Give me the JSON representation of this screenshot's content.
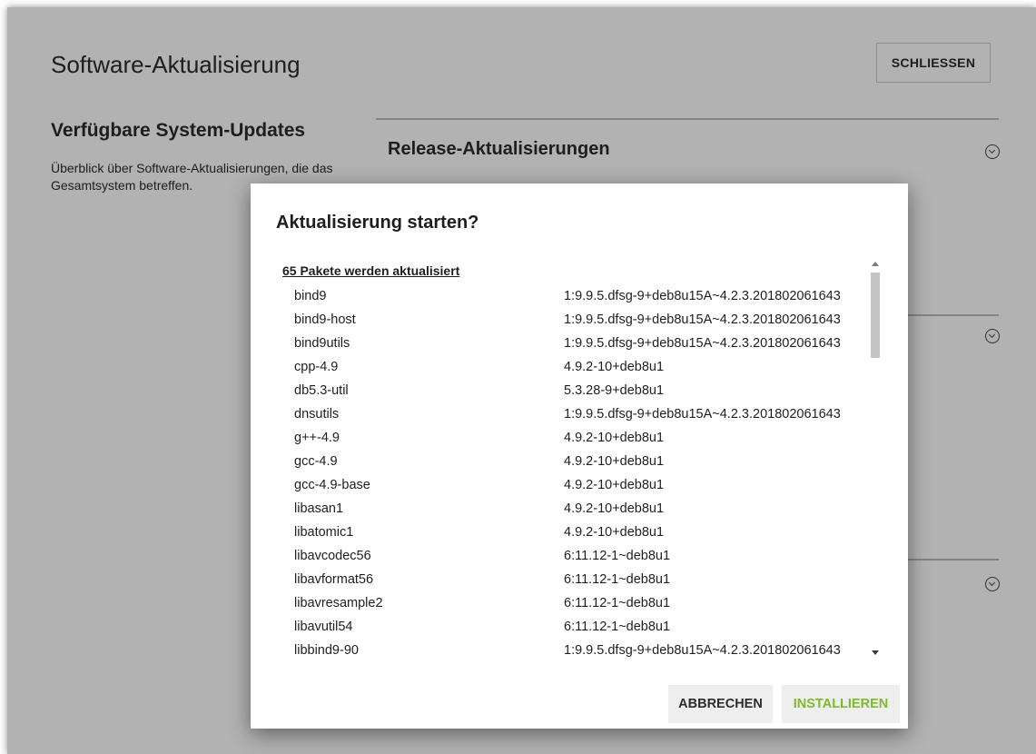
{
  "page": {
    "title": "Software-Aktualisierung",
    "close_label": "SCHLIESSEN"
  },
  "section": {
    "heading": "Verfügbare System-Updates",
    "description": "Überblick über Software-Aktualisierungen, die das Gesamtsystem betreffen."
  },
  "accordion": {
    "release_title": "Release-Aktualisierungen",
    "chevron_icon": "chevron-down-circle-icon"
  },
  "dialog": {
    "title": "Aktualisierung starten?",
    "list_header": "65 Pakete werden aktualisiert",
    "packages": [
      {
        "name": "bind9",
        "version": "1:9.9.5.dfsg-9+deb8u15A~4.2.3.201802061643"
      },
      {
        "name": "bind9-host",
        "version": "1:9.9.5.dfsg-9+deb8u15A~4.2.3.201802061643"
      },
      {
        "name": "bind9utils",
        "version": "1:9.9.5.dfsg-9+deb8u15A~4.2.3.201802061643"
      },
      {
        "name": "cpp-4.9",
        "version": "4.9.2-10+deb8u1"
      },
      {
        "name": "db5.3-util",
        "version": "5.3.28-9+deb8u1"
      },
      {
        "name": "dnsutils",
        "version": "1:9.9.5.dfsg-9+deb8u15A~4.2.3.201802061643"
      },
      {
        "name": "g++-4.9",
        "version": "4.9.2-10+deb8u1"
      },
      {
        "name": "gcc-4.9",
        "version": "4.9.2-10+deb8u1"
      },
      {
        "name": "gcc-4.9-base",
        "version": "4.9.2-10+deb8u1"
      },
      {
        "name": "libasan1",
        "version": "4.9.2-10+deb8u1"
      },
      {
        "name": "libatomic1",
        "version": "4.9.2-10+deb8u1"
      },
      {
        "name": "libavcodec56",
        "version": "6:11.12-1~deb8u1"
      },
      {
        "name": "libavformat56",
        "version": "6:11.12-1~deb8u1"
      },
      {
        "name": "libavresample2",
        "version": "6:11.12-1~deb8u1"
      },
      {
        "name": "libavutil54",
        "version": "6:11.12-1~deb8u1"
      },
      {
        "name": "libbind9-90",
        "version": "1:9.9.5.dfsg-9+deb8u15A~4.2.3.201802061643"
      }
    ],
    "cancel_label": "ABBRECHEN",
    "install_label": "INSTALLIEREN"
  },
  "colors": {
    "install_accent": "#7dbb2b",
    "overlay": "rgba(0,0,0,0.30)"
  }
}
